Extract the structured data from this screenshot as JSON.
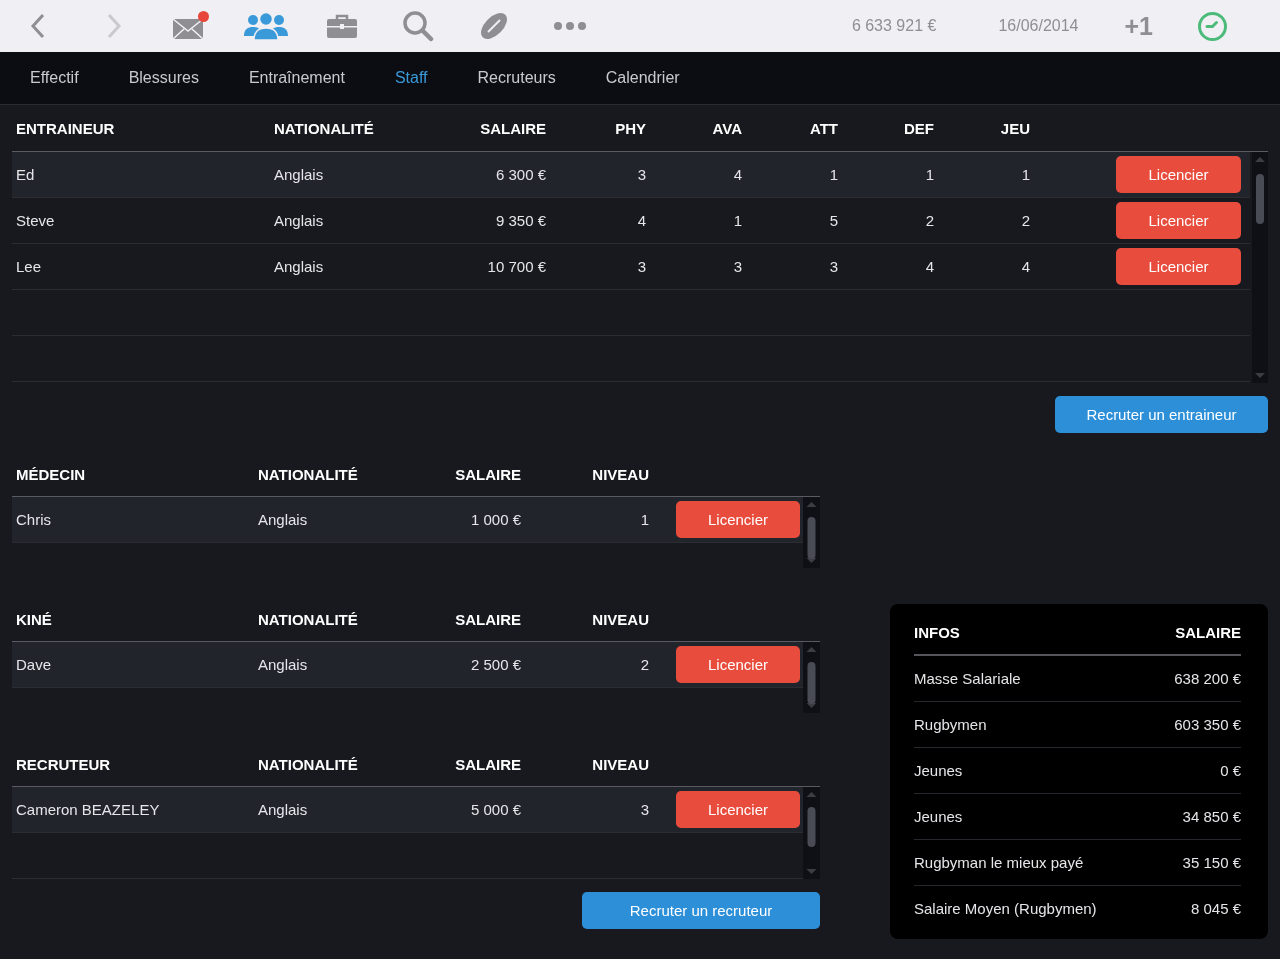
{
  "toolbar": [
    {
      "kind": "back",
      "selected": false,
      "disabled": false,
      "badge": false
    },
    {
      "kind": "forward",
      "selected": false,
      "disabled": true,
      "badge": false
    },
    {
      "kind": "mail",
      "selected": false,
      "disabled": false,
      "badge": true
    },
    {
      "kind": "team",
      "selected": true,
      "disabled": false,
      "badge": false
    },
    {
      "kind": "briefcase",
      "selected": false,
      "disabled": false,
      "badge": false
    },
    {
      "kind": "search",
      "selected": false,
      "disabled": false,
      "badge": false
    },
    {
      "kind": "ball",
      "selected": false,
      "disabled": false,
      "badge": false
    },
    {
      "kind": "more",
      "selected": false,
      "disabled": false,
      "badge": false
    }
  ],
  "status": {
    "balance": "6 633 921 €",
    "date": "16/06/2014",
    "advance": "+1"
  },
  "tabs": [
    {
      "label": "Effectif",
      "selected": false
    },
    {
      "label": "Blessures",
      "selected": false
    },
    {
      "label": "Entraînement",
      "selected": false
    },
    {
      "label": "Staff",
      "selected": true
    },
    {
      "label": "Recruteurs",
      "selected": false
    },
    {
      "label": "Calendrier",
      "selected": false
    }
  ],
  "coaches": {
    "columns": [
      "ENTRAINEUR",
      "NATIONALITÉ",
      "SALAIRE",
      "PHY",
      "AVA",
      "ATT",
      "DEF",
      "JEU"
    ],
    "rows": [
      {
        "cells": [
          "Ed",
          "Anglais",
          "6 300 €",
          "3",
          "4",
          "1",
          "1",
          "1"
        ],
        "action": "Licencier",
        "selected": true
      },
      {
        "cells": [
          "Steve",
          "Anglais",
          "9 350 €",
          "4",
          "1",
          "5",
          "2",
          "2"
        ],
        "action": "Licencier",
        "selected": false
      },
      {
        "cells": [
          "Lee",
          "Anglais",
          "10 700 €",
          "3",
          "3",
          "3",
          "4",
          "4"
        ],
        "action": "Licencier",
        "selected": false
      }
    ],
    "button": "Recruter un entraineur"
  },
  "staff_tables": [
    {
      "kind": "single",
      "columns": [
        "MÉDECIN",
        "NATIONALITÉ",
        "SALAIRE",
        "NIVEAU"
      ],
      "rows": [
        {
          "cells": [
            "Chris",
            "Anglais",
            "1 000 €",
            "1"
          ],
          "action": "Licencier",
          "selected": true
        }
      ]
    },
    {
      "kind": "single",
      "columns": [
        "KINÉ",
        "NATIONALITÉ",
        "SALAIRE",
        "NIVEAU"
      ],
      "rows": [
        {
          "cells": [
            "Dave",
            "Anglais",
            "2 500 €",
            "2"
          ],
          "action": "Licencier",
          "selected": true
        }
      ]
    },
    {
      "kind": "double",
      "columns": [
        "RECRUTEUR",
        "NATIONALITÉ",
        "SALAIRE",
        "NIVEAU"
      ],
      "rows": [
        {
          "cells": [
            "Cameron BEAZELEY",
            "Anglais",
            "5 000 €",
            "3"
          ],
          "action": "Licencier",
          "selected": true
        }
      ]
    }
  ],
  "recruit_button": "Recruter un recruteur",
  "infos": {
    "columns": [
      "INFOS",
      "SALAIRE"
    ],
    "rows": [
      {
        "label": "Masse Salariale",
        "value": "638 200 €"
      },
      {
        "label": "Rugbymen",
        "value": "603 350 €"
      },
      {
        "label": "Jeunes",
        "value": "0 €"
      },
      {
        "label": "Jeunes",
        "value": "34 850 €"
      },
      {
        "label": "Rugbyman le mieux payé",
        "value": "35 150 €"
      },
      {
        "label": "Salaire Moyen (Rugbymen)",
        "value": "8 045 €"
      }
    ]
  }
}
